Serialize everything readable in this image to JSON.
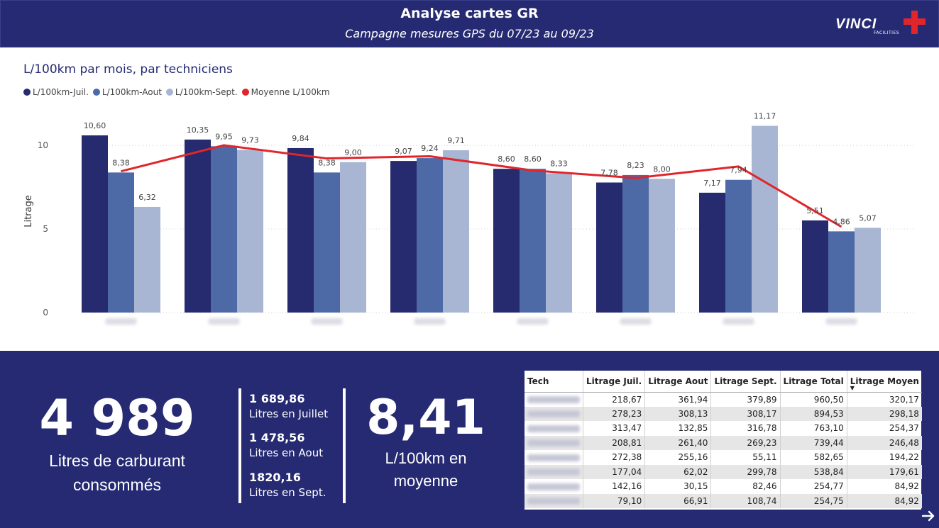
{
  "header": {
    "title": "Analyse cartes GR",
    "subtitle": "Campagne mesures GPS du 07/23 au 09/23",
    "logo_text": "VINCI",
    "logo_sub": "FACILITIES"
  },
  "colors": {
    "navy": "#252a72",
    "july": "#262a6e",
    "august": "#4d6aa6",
    "september": "#a8b6d3",
    "average_line": "#e0262b"
  },
  "chart_data": {
    "type": "bar",
    "title": "L/100km par mois, par techniciens",
    "ylabel": "Litrage",
    "ylim": [
      0,
      12
    ],
    "yticks": [
      0,
      5,
      10
    ],
    "grid": true,
    "legend_position": "top-left",
    "categories": [
      "",
      "",
      "",
      "",
      "",
      "",
      "",
      ""
    ],
    "series": [
      {
        "name": "L/100km-Juil.",
        "values": [
          10.6,
          10.35,
          9.84,
          9.07,
          8.6,
          7.78,
          7.17,
          5.51
        ]
      },
      {
        "name": "L/100km-Aout",
        "values": [
          8.38,
          9.95,
          8.38,
          9.24,
          8.6,
          8.23,
          7.94,
          4.86
        ]
      },
      {
        "name": "L/100km-Sept.",
        "values": [
          6.32,
          9.73,
          9.0,
          9.71,
          8.33,
          8.0,
          11.17,
          5.07
        ]
      },
      {
        "name": "Moyenne L/100km",
        "type": "line",
        "values": [
          8.45,
          10.01,
          9.22,
          9.35,
          8.5,
          8.05,
          8.74,
          5.13
        ]
      }
    ],
    "value_labels": [
      [
        "10,60",
        "10,35",
        "9,84",
        "9,07",
        "8,60",
        "7,78",
        "7,17",
        "5,51"
      ],
      [
        "8,38",
        "9,95",
        "8,38",
        "9,24",
        "8,60",
        "8,23",
        "7,94",
        "4,86"
      ],
      [
        "6,32",
        "9,73",
        "9,00",
        "9,71",
        "8,33",
        "8,00",
        "11,17",
        "5,07"
      ]
    ]
  },
  "kpis": {
    "total_value": "4 989",
    "total_label_1": "Litres de carburant",
    "total_label_2": "consommés",
    "months": [
      {
        "value": "1 689,86",
        "label": "Litres en Juillet"
      },
      {
        "value": "1 478,56",
        "label": "Litres en Aout"
      },
      {
        "value": "1820,16",
        "label": "Litres en Sept."
      }
    ],
    "avg_value": "8,41",
    "avg_label_1": "L/100km en",
    "avg_label_2": "moyenne"
  },
  "table": {
    "headers": [
      "Tech",
      "Litrage Juil.",
      "Litrage Aout",
      "Litrage Sept.",
      "Litrage Total",
      "Litrage Moyen"
    ],
    "sort_indicator": "▼",
    "rows": [
      [
        "218,67",
        "361,94",
        "379,89",
        "960,50",
        "320,17"
      ],
      [
        "278,23",
        "308,13",
        "308,17",
        "894,53",
        "298,18"
      ],
      [
        "313,47",
        "132,85",
        "316,78",
        "763,10",
        "254,37"
      ],
      [
        "208,81",
        "261,40",
        "269,23",
        "739,44",
        "246,48"
      ],
      [
        "272,38",
        "255,16",
        "55,11",
        "582,65",
        "194,22"
      ],
      [
        "177,04",
        "62,02",
        "299,78",
        "538,84",
        "179,61"
      ],
      [
        "142,16",
        "30,15",
        "82,46",
        "254,77",
        "84,92"
      ],
      [
        "79,10",
        "66,91",
        "108,74",
        "254,75",
        "84,92"
      ]
    ]
  },
  "nav": {
    "next_icon": "arrow-right-icon"
  }
}
